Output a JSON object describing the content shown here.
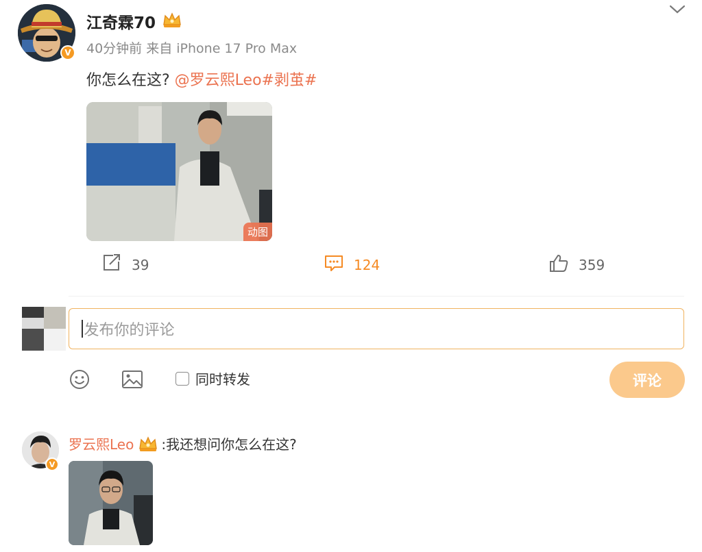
{
  "post": {
    "username": "江奇霖70",
    "meta": "40分钟前 来自 iPhone 17 Pro Max",
    "text_prefix": "你怎么在这? ",
    "mention": "@罗云熙Leo",
    "hashtag": "#剥茧#",
    "media_badge": "动图"
  },
  "actions": {
    "repost_count": "39",
    "comment_count": "124",
    "like_count": "359"
  },
  "composer": {
    "placeholder": "发布你的评论",
    "repost_label": "同时转发",
    "submit_label": "评论"
  },
  "reply": {
    "username": "罗云熙Leo",
    "text": ":我还想问你怎么在这?"
  },
  "colors": {
    "accent": "#eb7350",
    "active": "#f58a23",
    "button": "#fbc98c",
    "border": "#f0b25e"
  },
  "icons": [
    "verified-badge-icon",
    "crown-icon",
    "chevron-down-icon",
    "repost-icon",
    "comment-icon",
    "like-icon",
    "emoji-icon",
    "image-icon"
  ]
}
